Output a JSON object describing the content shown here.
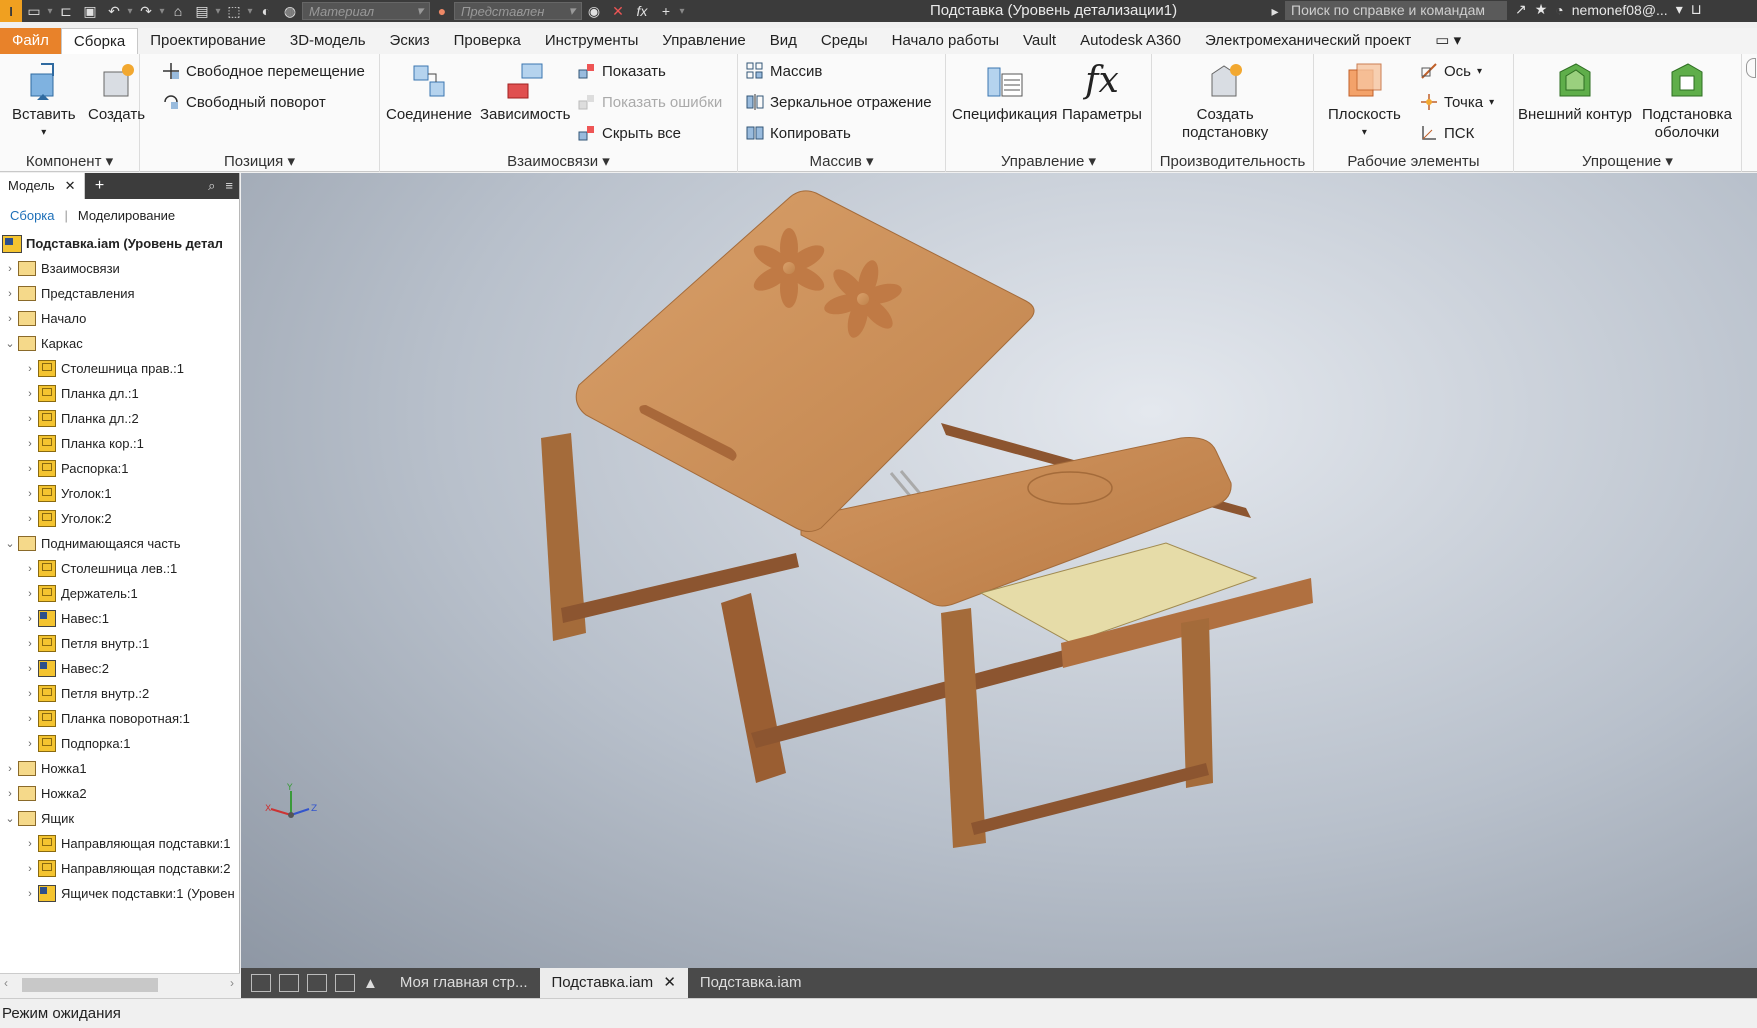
{
  "titlebar": {
    "title": "Подставка (Уровень детализации1)",
    "material_placeholder": "Материал",
    "appearance_placeholder": "Представлен",
    "search": "Поиск по справке и командам",
    "user": "nemonef08@..."
  },
  "tabs": [
    "Файл",
    "Сборка",
    "Проектирование",
    "3D-модель",
    "Эскиз",
    "Проверка",
    "Инструменты",
    "Управление",
    "Вид",
    "Среды",
    "Начало работы",
    "Vault",
    "Autodesk A360",
    "Электромеханический проект"
  ],
  "ribbon": {
    "component": {
      "label": "Компонент",
      "insert": "Вставить",
      "create": "Создать"
    },
    "position": {
      "label": "Позиция",
      "free_move": "Свободное перемещение",
      "free_rotate": "Свободный поворот"
    },
    "relationships": {
      "label": "Взаимосвязи",
      "joint": "Соединение",
      "constrain": "Зависимость",
      "show": "Показать",
      "show_errors": "Показать ошибки",
      "hide_all": "Скрыть все"
    },
    "pattern": {
      "label": "Массив",
      "pattern": "Массив",
      "mirror": "Зеркальное отражение",
      "copy": "Копировать"
    },
    "manage": {
      "label": "Управление",
      "bom": "Спецификация",
      "params": "Параметры"
    },
    "productivity": {
      "label": "Производительность",
      "substitute_line1": "Создать",
      "substitute_line2": "подстановку"
    },
    "work_features": {
      "label": "Рабочие элементы",
      "plane": "Плоскость",
      "axis": "Ось",
      "point": "Точка",
      "ucs": "ПСК"
    },
    "simplification": {
      "label": "Упрощение",
      "shrinkwrap": "Внешний контур",
      "shell_line1": "Подстановка",
      "shell_line2": "оболочки"
    }
  },
  "browser": {
    "tab": "Модель",
    "subtab_assembly": "Сборка",
    "subtab_modeling": "Моделирование",
    "root": "Подставка.iam (Уровень детал",
    "nodes": [
      {
        "label": "Взаимосвязи",
        "level": 0,
        "icon": "folder"
      },
      {
        "label": "Представления",
        "level": 0,
        "icon": "folder"
      },
      {
        "label": "Начало",
        "level": 0,
        "icon": "folder"
      },
      {
        "label": "Каркас",
        "level": 0,
        "icon": "folder",
        "open": true
      },
      {
        "label": "Столешница прав.:1",
        "level": 1,
        "icon": "part-disabled"
      },
      {
        "label": "Планка дл.:1",
        "level": 1,
        "icon": "part"
      },
      {
        "label": "Планка дл.:2",
        "level": 1,
        "icon": "part"
      },
      {
        "label": "Планка кор.:1",
        "level": 1,
        "icon": "part"
      },
      {
        "label": "Распорка:1",
        "level": 1,
        "icon": "part"
      },
      {
        "label": "Уголок:1",
        "level": 1,
        "icon": "part"
      },
      {
        "label": "Уголок:2",
        "level": 1,
        "icon": "part"
      },
      {
        "label": "Поднимающаяся часть",
        "level": 0,
        "icon": "folder",
        "open": true
      },
      {
        "label": "Столешница лев.:1",
        "level": 1,
        "icon": "part"
      },
      {
        "label": "Держатель:1",
        "level": 1,
        "icon": "part"
      },
      {
        "label": "Навес:1",
        "level": 1,
        "icon": "assembly"
      },
      {
        "label": "Петля внутр.:1",
        "level": 1,
        "icon": "part"
      },
      {
        "label": "Навес:2",
        "level": 1,
        "icon": "assembly"
      },
      {
        "label": "Петля внутр.:2",
        "level": 1,
        "icon": "part"
      },
      {
        "label": "Планка поворотная:1",
        "level": 1,
        "icon": "part"
      },
      {
        "label": "Подпорка:1",
        "level": 1,
        "icon": "part"
      },
      {
        "label": "Ножка1",
        "level": 0,
        "icon": "folder"
      },
      {
        "label": "Ножка2",
        "level": 0,
        "icon": "folder"
      },
      {
        "label": "Ящик",
        "level": 0,
        "icon": "folder",
        "open": true
      },
      {
        "label": "Направляющая подставки:1",
        "level": 1,
        "icon": "part"
      },
      {
        "label": "Направляющая подставки:2",
        "level": 1,
        "icon": "part"
      },
      {
        "label": "Ящичек подставки:1 (Уровен",
        "level": 1,
        "icon": "assembly"
      }
    ]
  },
  "doc_tabs": [
    "Моя главная стр...",
    "Подставка.iam",
    "Подставка.iam"
  ],
  "status": "Режим ожидания",
  "colors": {
    "file_tab": "#e8822a",
    "wood": "#c98a52",
    "wood_dark": "#9a5e32",
    "drawer": "#e6dca8"
  }
}
